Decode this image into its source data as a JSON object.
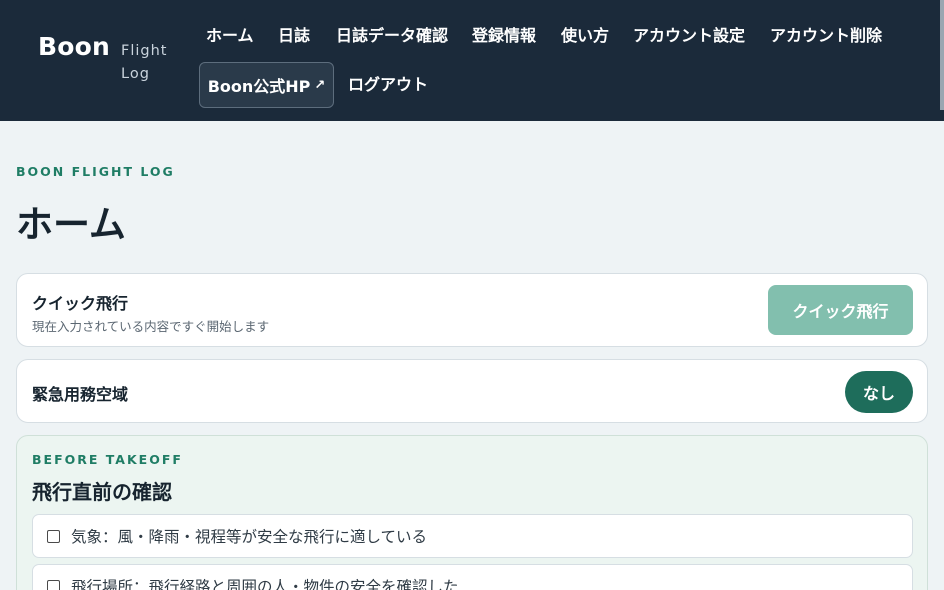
{
  "header": {
    "brand": "Boon",
    "brand_sub_1": "Flight",
    "brand_sub_2": "Log",
    "nav": {
      "home": "ホーム",
      "journal": "日誌",
      "journal_data": "日誌データ確認",
      "registration": "登録情報",
      "usage": "使い方",
      "account_settings": "アカウント設定",
      "account_delete": "アカウント削除",
      "official_hp": "Boon公式HP",
      "official_hp_arrow": "↗",
      "logout": "ログアウト"
    }
  },
  "main": {
    "eyebrow": "BOON FLIGHT LOG",
    "title": "ホーム",
    "quick_flight": {
      "title": "クイック飛行",
      "description": "現在入力されている内容ですぐ開始します",
      "button": "クイック飛行"
    },
    "emergency_airspace": {
      "title": "緊急用務空域",
      "status": "なし"
    },
    "before_takeoff": {
      "eyebrow": "BEFORE TAKEOFF",
      "title": "飛行直前の確認",
      "items": [
        "気象：風・降雨・視程等が安全な飛行に適している",
        "飛行場所：飛行経路と周囲の人・物件の安全を確認した"
      ]
    }
  },
  "colors": {
    "header_bg": "#1b2a3a",
    "accent": "#1f7d65",
    "quick_button": "#82bfae",
    "status_pill": "#1e6d5b"
  }
}
